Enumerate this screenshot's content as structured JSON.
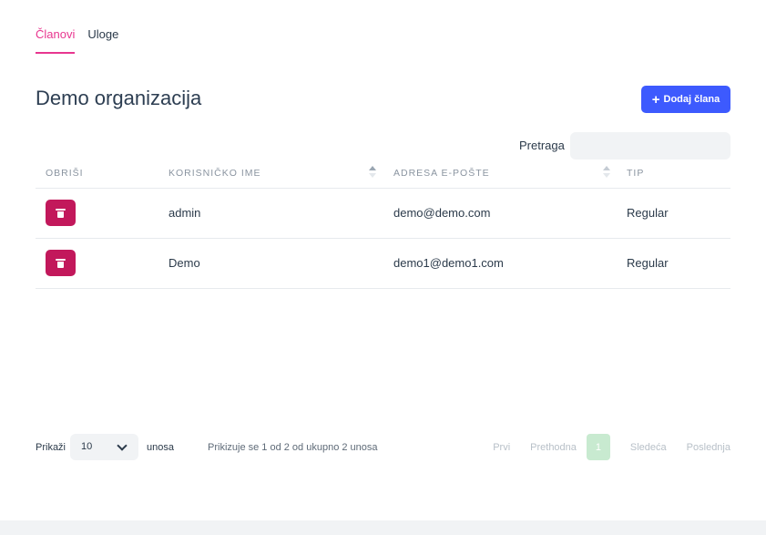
{
  "tabs": [
    {
      "label": "Članovi",
      "active": true
    },
    {
      "label": "Uloge",
      "active": false
    }
  ],
  "page": {
    "title": "Demo organizacija",
    "add_button_label": "Dodaj člana"
  },
  "search": {
    "label": "Pretraga",
    "value": "",
    "placeholder": ""
  },
  "table": {
    "columns": [
      "OBRIŠI",
      "KORISNIČKO IME",
      "ADRESA E-POŠTE",
      "TIP"
    ],
    "rows": [
      {
        "username": "admin",
        "email": "demo@demo.com",
        "type": "Regular"
      },
      {
        "username": "Demo",
        "email": "demo1@demo1.com",
        "type": "Regular"
      }
    ]
  },
  "footer": {
    "show_label": "Prikaži",
    "page_size": "10",
    "entries_label": "unosa",
    "info": "Prikizuje se 1 od 2 od ukupno 2 unosa",
    "pager": {
      "first": "Prvi",
      "previous": "Prethodna",
      "current": "1",
      "next": "Sledeća",
      "last": "Poslednja"
    }
  },
  "colors": {
    "accent_pink": "#e8368f",
    "primary_blue": "#3d5afe",
    "delete_red": "#c2185b",
    "current_page_green": "#c8ead0"
  },
  "icons": {
    "add": "plus-icon",
    "delete": "trash-icon",
    "select": "chevron-down-icon",
    "sort": "sort-arrows-icon"
  }
}
